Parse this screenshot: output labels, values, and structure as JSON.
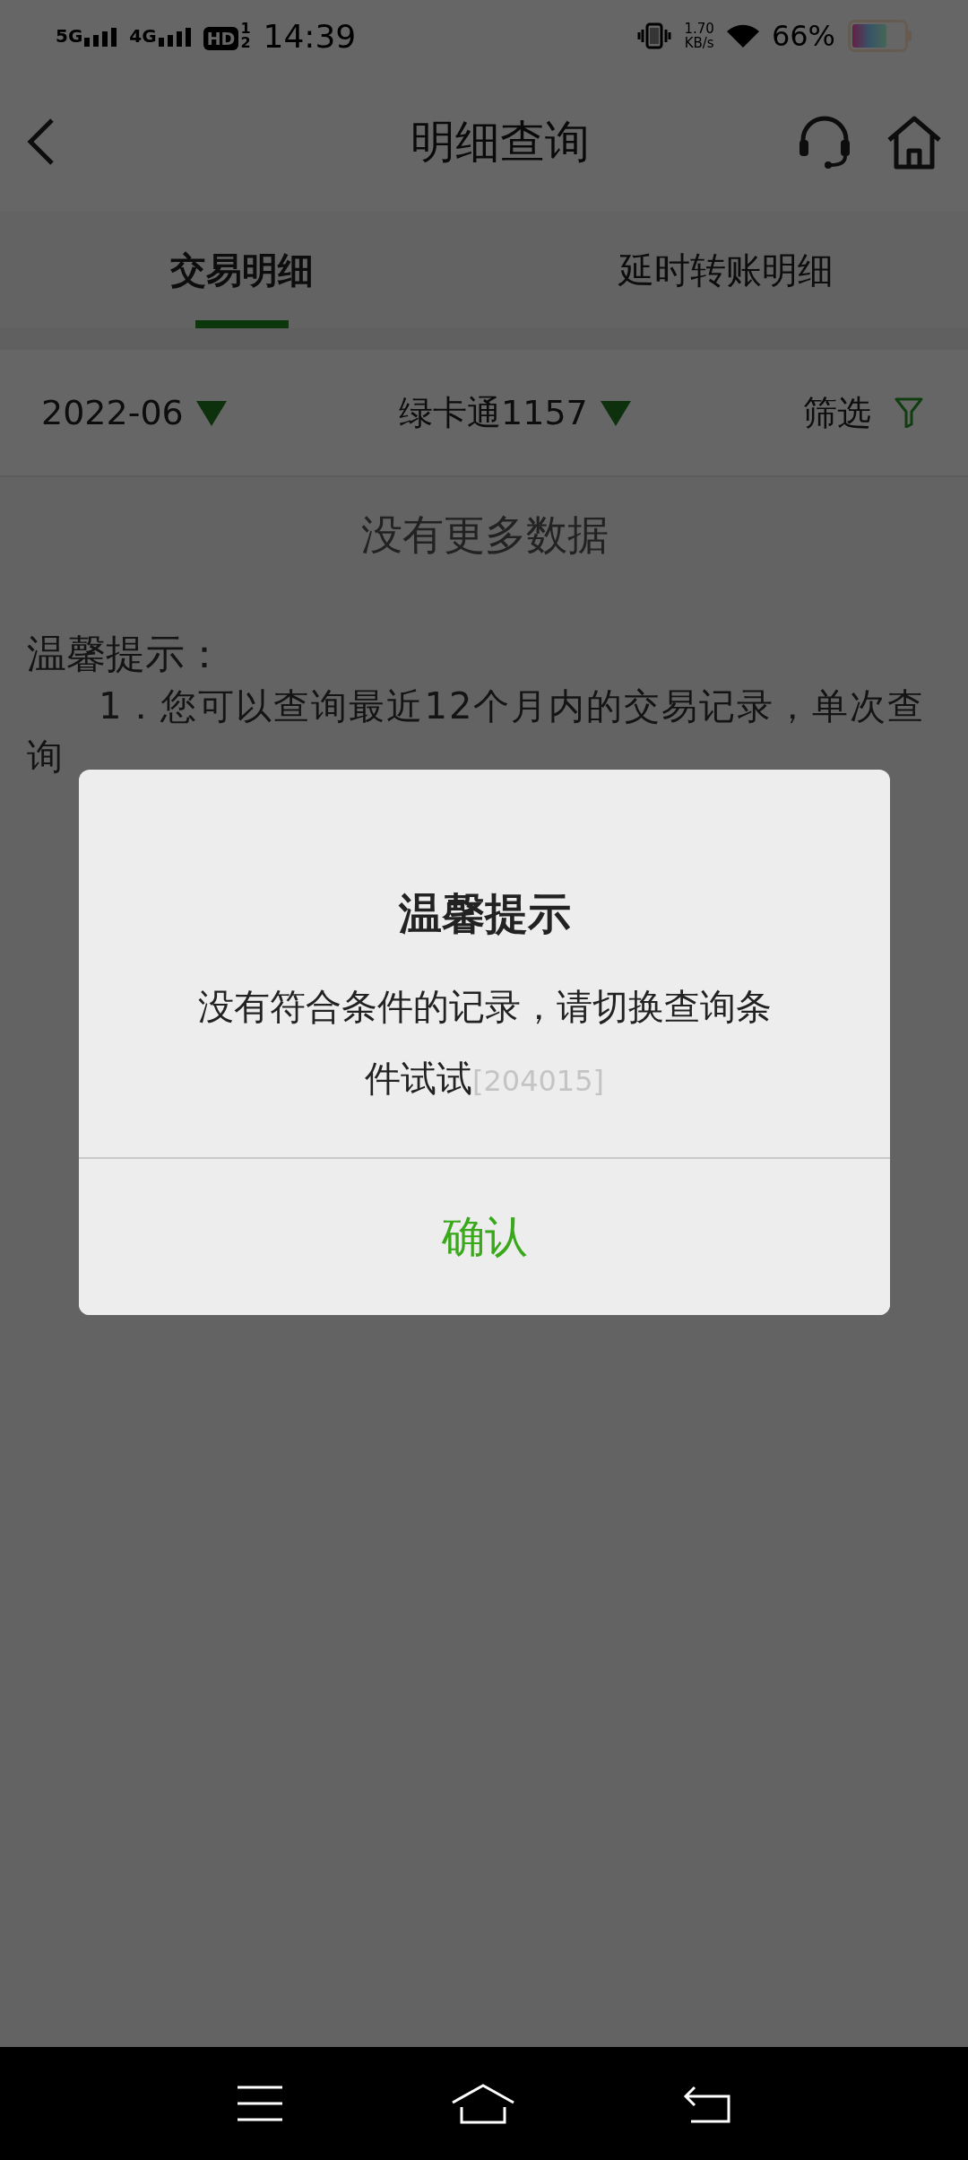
{
  "status_bar": {
    "network_1": "5G",
    "network_2": "4G",
    "hd": "HD",
    "hd_sim_1": "1",
    "hd_sim_2": "2",
    "time": "14:39",
    "speed": "1.70",
    "speed_unit": "KB/s",
    "battery": "66%"
  },
  "header": {
    "title": "明细查询"
  },
  "tabs": [
    {
      "label": "交易明细",
      "selected": true
    },
    {
      "label": "延时转账明细",
      "selected": false
    }
  ],
  "filters": [
    {
      "kind": "dropdown",
      "label": "2022-06"
    },
    {
      "kind": "dropdown",
      "label": "绿卡通1157"
    },
    {
      "kind": "filter",
      "label": "筛选"
    }
  ],
  "empty_message": "没有更多数据",
  "tips": {
    "title": "温馨提示：",
    "line": "1．您可以查询最近12个月内的交易记录，单次查询"
  },
  "dialog": {
    "title": "温馨提示",
    "message": "没有符合条件的记录，请切换查询条件试试",
    "code": "[204015]",
    "confirm": "确认"
  }
}
